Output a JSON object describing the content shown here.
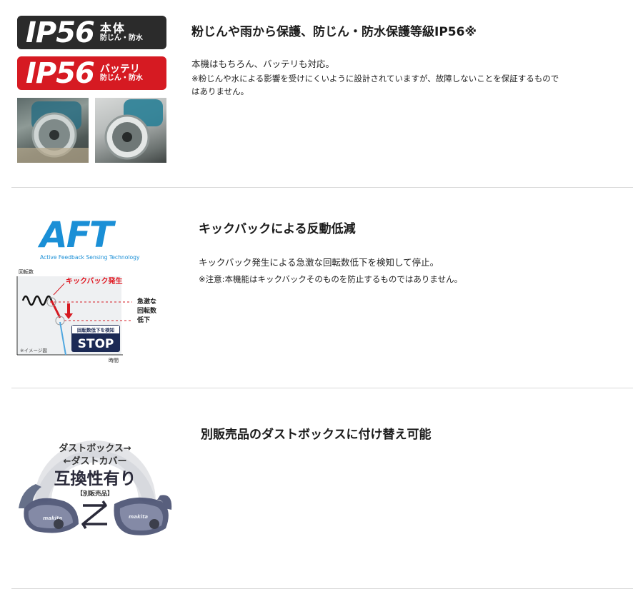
{
  "section1": {
    "badge_body": {
      "code": "IP56",
      "part": "本体",
      "sub": "防じん・防水"
    },
    "badge_battery": {
      "code": "IP56",
      "part": "バッテリ",
      "sub": "防じん・防水"
    },
    "title": "粉じんや雨から保護、防じん・防水保護等級IP56※",
    "desc": "本機はもちろん、バッテリも対応。",
    "note_line1": "※粉じんや水による影響を受けにくいように設計されていますが、故障しないことを保証するもので",
    "note_line2": "はありません。"
  },
  "section2": {
    "logo_text": "AFT",
    "logo_sub": "Active Feedback Sensing Technology",
    "diagram": {
      "y_axis": "回転数",
      "x_axis": "時間",
      "kickback_label": "キックバック発生",
      "drop_label_1": "急激な",
      "drop_label_2": "回転数",
      "drop_label_3": "低下",
      "detect_label": "回転数低下を検知",
      "stop_label": "STOP",
      "image_note": "※イメージ図"
    },
    "title": "キックバックによる反動低減",
    "desc": "キックバック発生による急激な回転数低下を検知して停止。",
    "note": "※注意:本機能はキックバックそのものを防止するものではありません。"
  },
  "section3": {
    "arc_line1": "ダストボックス→",
    "arc_line2": "←ダストカバー",
    "compat": "互換性有り",
    "sold_separately": "【別販売品】",
    "brand": "makita",
    "title": "別販売品のダストボックスに付け替え可能"
  },
  "colors": {
    "badge_dark": "#2b2b2b",
    "badge_red": "#d61a22",
    "aft_blue": "#1a8fd6",
    "kickback_red": "#e0141e",
    "stop_navy": "#1c2a55"
  }
}
